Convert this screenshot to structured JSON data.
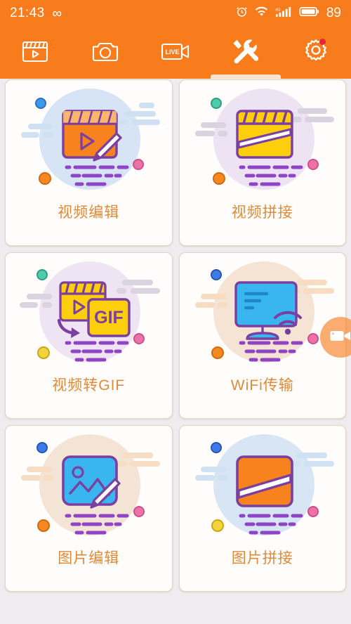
{
  "status_bar": {
    "time": "21:43",
    "infinity_icon": "infinity-icon",
    "alarm_icon": "alarm-clock-icon",
    "wifi_icon": "wifi-icon",
    "signal_icon": "signal-bars-4g-icon",
    "signal_label": "4G",
    "battery_icon": "battery-icon",
    "battery_level": "89",
    "background_color": "#F87C1B"
  },
  "tabbar": {
    "background_color": "#F87C1B",
    "active_index": 3,
    "tabs": [
      {
        "name": "tab-video",
        "icon": "clapperboard-play-icon",
        "active": false,
        "badge": false
      },
      {
        "name": "tab-camera",
        "icon": "camera-icon",
        "active": false,
        "badge": false
      },
      {
        "name": "tab-live",
        "icon": "live-video-icon",
        "active": false,
        "badge": false
      },
      {
        "name": "tab-tools",
        "icon": "tools-wrench-screwdriver-icon",
        "active": true,
        "badge": false
      },
      {
        "name": "tab-settings",
        "icon": "gear-icon",
        "active": false,
        "badge": true
      }
    ]
  },
  "main": {
    "background_color": "#EEECEE",
    "label_color": "#E08A38",
    "cards": [
      {
        "id": "video-edit",
        "label": "视频编辑",
        "icon": "clapperboard-pencil-icon",
        "circle_color": "#D6E4F5",
        "cloud_color": "#CFE0F3",
        "dots": [
          "#3C9BE8",
          "#F070A8",
          "#F5891F"
        ],
        "accent_color": "#F7821E"
      },
      {
        "id": "video-merge",
        "label": "视频拼接",
        "icon": "clapperboard-split-icon",
        "circle_color": "#EEE3F2",
        "cloud_color": "#D8D3DE",
        "dots": [
          "#4ECCAC",
          "#F070A8",
          "#F5891F"
        ],
        "accent_color": "#FCCE0C"
      },
      {
        "id": "video-to-gif",
        "label": "视频转GIF",
        "icon": "clapperboard-to-gif-icon",
        "circle_color": "#EFE4F4",
        "cloud_color": "#D9D4DF",
        "dots": [
          "#4ECCAC",
          "#F070A8",
          "#F2D33B"
        ],
        "accent_color": "#FCCE0C"
      },
      {
        "id": "wifi-transfer",
        "label": "WiFi传输",
        "icon": "monitor-wifi-icon",
        "circle_color": "#F5E3D4",
        "cloud_color": "#F7DCC1",
        "dots": [
          "#3C7BE8",
          "#F070A8",
          "#F5891F"
        ],
        "accent_color": "#39B6F0"
      },
      {
        "id": "photo-edit",
        "label": "图片编辑",
        "icon": "photo-pencil-icon",
        "circle_color": "#F4E4D6",
        "cloud_color": "#F6DDC4",
        "dots": [
          "#3C7BE8",
          "#F070A8",
          "#F5891F"
        ],
        "accent_color": "#39B6F0"
      },
      {
        "id": "photo-merge",
        "label": "图片拼接",
        "icon": "photo-split-icon",
        "circle_color": "#D7E5F5",
        "cloud_color": "#CFE1F3",
        "dots": [
          "#3C7BE8",
          "#F070A8",
          "#F2D33B"
        ],
        "accent_color": "#F7821E"
      }
    ]
  },
  "fab": {
    "name": "floating-record-button",
    "icon": "video-camera-icon",
    "color": "#F87C1B"
  }
}
